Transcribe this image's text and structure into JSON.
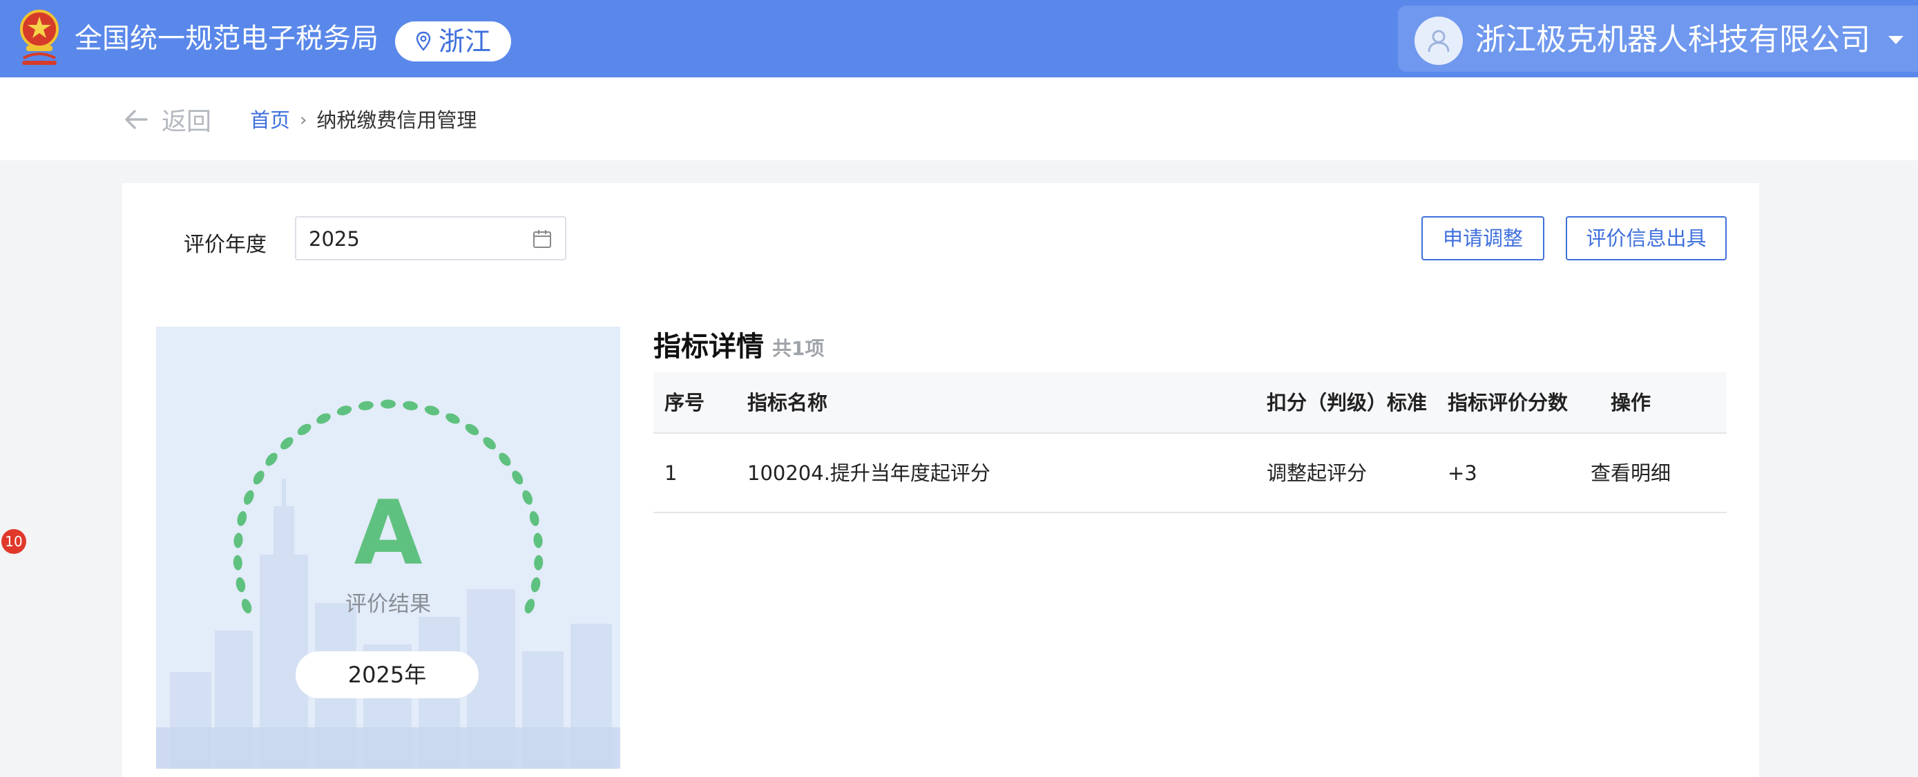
{
  "header": {
    "site_title": "全国统一规范电子税务局",
    "region": "浙江",
    "user_name": "浙江极克机器人科技有限公司"
  },
  "nav": {
    "back_label": "返回",
    "breadcrumb": [
      "首页",
      "纳税缴费信用管理"
    ]
  },
  "filter": {
    "year_label": "评价年度",
    "year_value": "2025"
  },
  "actions": {
    "adjust_label": "申请调整",
    "issue_label": "评价信息出具"
  },
  "result": {
    "grade": "A",
    "label": "评价结果",
    "year": "2025年"
  },
  "details": {
    "title": "指标详情",
    "count": "共1项",
    "columns": [
      "序号",
      "指标名称",
      "扣分（判级）标准",
      "指标评价分数",
      "操作"
    ],
    "rows": [
      {
        "index": "1",
        "name": "100204.提升当年度起评分",
        "standard": "调整起评分",
        "score": "+3",
        "action": "查看明细"
      }
    ]
  },
  "side_badge": "10",
  "colors": {
    "header_bg": "#5a88ea",
    "accent": "#3e6fdc",
    "grade_green": "#5fc17f",
    "badge_red": "#e0392b"
  }
}
